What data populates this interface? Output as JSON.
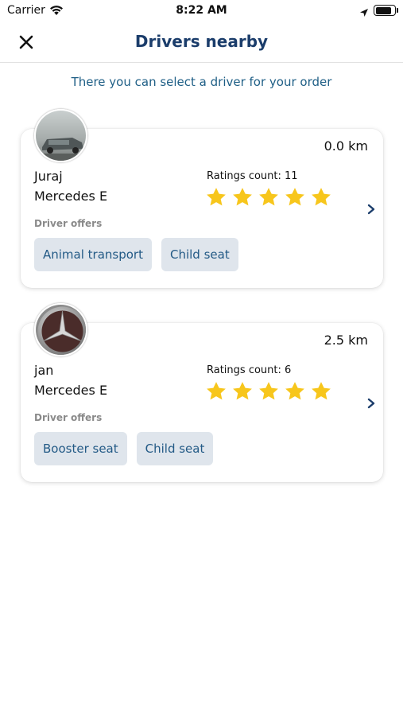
{
  "status_bar": {
    "carrier": "Carrier",
    "time": "8:22 AM",
    "battery_level": 0.9
  },
  "nav": {
    "title": "Drivers nearby",
    "close_icon": "close-icon"
  },
  "subtitle": "There you can select a driver for your order",
  "colors": {
    "title": "#1b3d6b",
    "subtitle": "#1f5f86",
    "star": "#f7c61c",
    "chip_bg": "#dfe5ec",
    "chip_text": "#235a86"
  },
  "drivers": [
    {
      "name": "Juraj",
      "car": "Mercedes E",
      "distance": "0.0 km",
      "ratings_count": "Ratings count: 11",
      "stars": 5,
      "offers_label": "Driver offers",
      "offers": [
        "Animal transport",
        "Child seat"
      ]
    },
    {
      "name": "jan",
      "car": "Mercedes E",
      "distance": "2.5 km",
      "ratings_count": "Ratings count: 6",
      "stars": 5,
      "offers_label": "Driver offers",
      "offers": [
        "Booster seat",
        "Child seat"
      ]
    }
  ]
}
